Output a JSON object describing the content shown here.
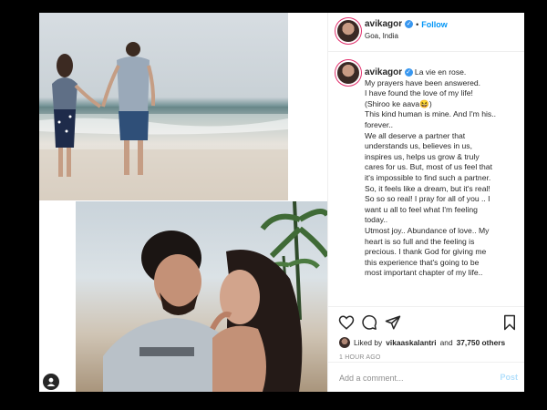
{
  "post": {
    "username": "avikagor",
    "follow_label": "Follow",
    "location": "Goa, India",
    "caption_title": "La vie en rose.",
    "caption_body": "My prayers have been answered.\nI have found the love of my life!\n(Shiroo ke aava😆)\nThis kind human is mine. And I'm his..\nforever..\nWe all deserve a partner that\nunderstands us, believes in us,\ninspires us, helps us grow & truly\ncares for us. But, most of us feel that\nit's impossible to find such a partner.\nSo, it feels like a dream, but it's real!\nSo so so real! I pray for all of you .. I\nwant u all to feel what I'm feeling\ntoday..\nUtmost joy.. Abundance of love.. My\nheart is so full and the feeling is\nprecious. I thank God for giving me\nthis experience that's going to be\nmost important chapter of my life..",
    "liked_by_prefix": "Liked by",
    "liked_by_user": "vikaaskalantri",
    "liked_by_and": "and",
    "liked_by_others": "37,750 others",
    "time_ago": "1 HOUR AGO"
  },
  "comment": {
    "placeholder": "Add a comment...",
    "post_label": "Post"
  },
  "icons": {
    "verified": "verified-badge-icon",
    "like": "heart-icon",
    "comment": "comment-bubble-icon",
    "share": "paper-plane-icon",
    "save": "bookmark-icon"
  },
  "colors": {
    "link_blue": "#0095f6",
    "verified_blue": "#3897f0",
    "muted_text": "#8e8e8e",
    "post_disabled": "#b2dffc"
  }
}
